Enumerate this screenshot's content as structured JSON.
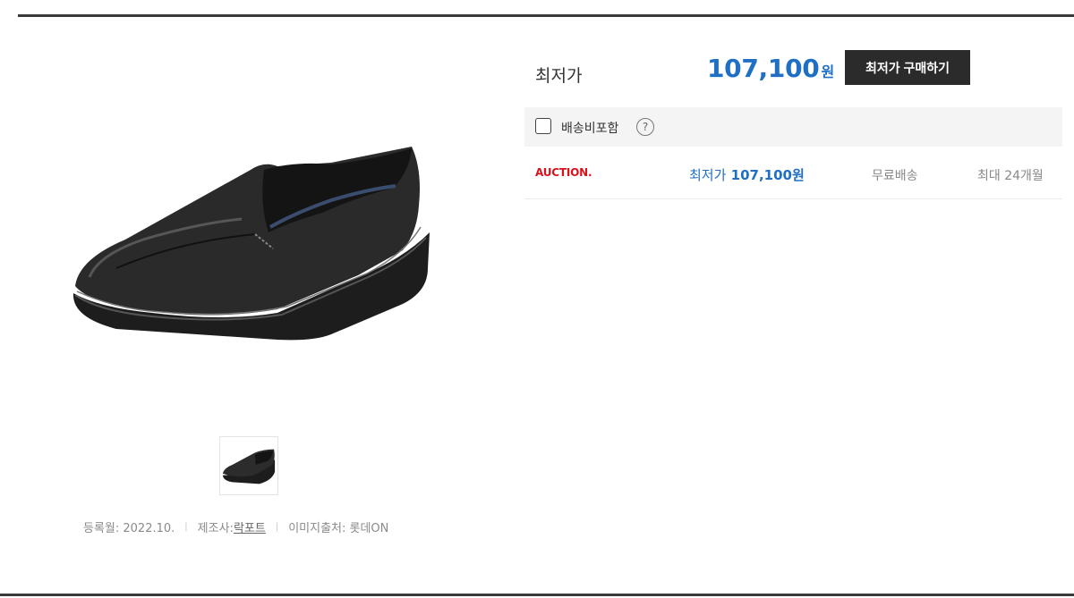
{
  "price_box": {
    "lowest_label": "최저가",
    "lowest_price": "107,100",
    "currency": "원",
    "buy_button_label": "최저가 구매하기"
  },
  "filter": {
    "shipping_included_label": "배송비포함",
    "help_symbol": "?",
    "checked": false
  },
  "sellers": [
    {
      "name": "AUCTION.",
      "price_prefix": "최저가",
      "price": "107,100원",
      "shipping": "무료배송",
      "installment": "최대 24개월"
    }
  ],
  "product_info": {
    "reg_date": "등록월: 2022.10.",
    "maker_prefix": "제조사:",
    "maker_name": "락포트",
    "image_source": "이미지출처: 롯데ON",
    "separator": "|"
  },
  "colors": {
    "price_blue": "#1f6fc5",
    "auction_red": "#d9121b",
    "button_dark": "#2b2b2b"
  },
  "icons": {
    "checkbox": "checkbox-icon",
    "help": "question-circle-icon"
  }
}
